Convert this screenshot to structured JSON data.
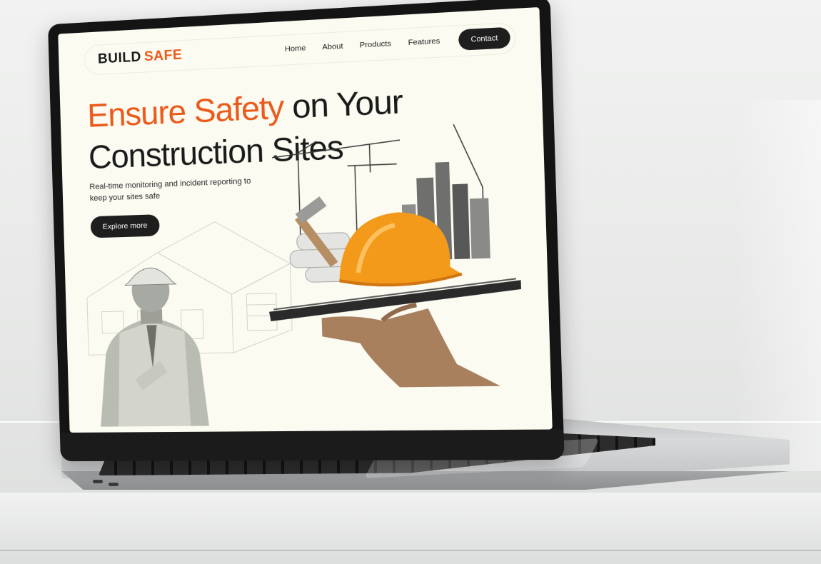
{
  "site": {
    "logo": {
      "part1": "BUILD",
      "part2": "SAFE"
    },
    "nav": {
      "links": [
        "Home",
        "About",
        "Products",
        "Features"
      ],
      "contact_label": "Contact"
    },
    "hero": {
      "headline_accent": "Ensure Safety",
      "headline_line1_rest": " on Your",
      "headline_line2": "Construction Sites",
      "subtitle": "Real-time monitoring and incident reporting to keep your sites safe",
      "cta_label": "Explore more"
    }
  },
  "colors": {
    "accent": "#ea5a1a",
    "dark": "#1e1e1e",
    "page_bg": "#fbfbf2",
    "helmet": "#f39a1a"
  },
  "icons": [
    "hard-hat-icon",
    "crane-icon",
    "hammer-icon"
  ]
}
